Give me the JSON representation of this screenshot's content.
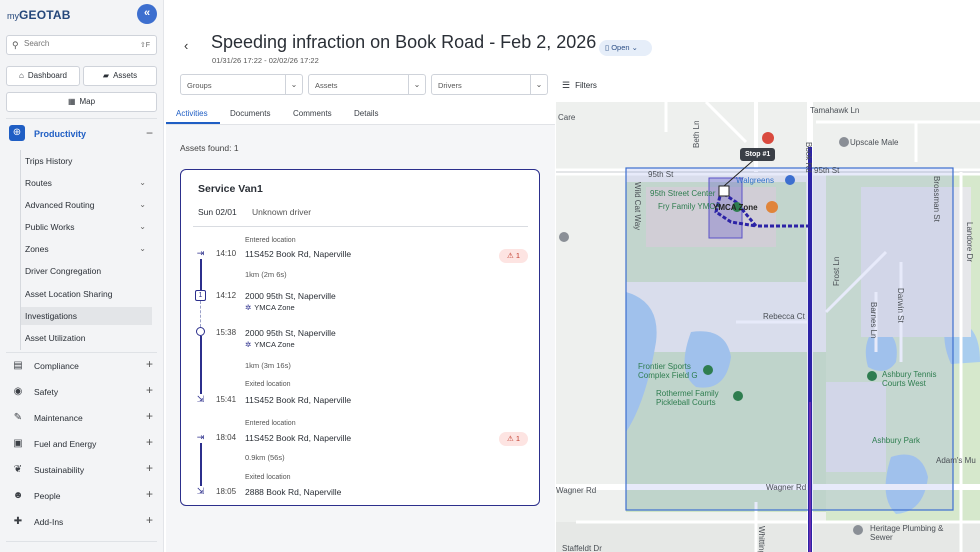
{
  "app": {
    "logo_prefix": "my",
    "logo_main": "GEOTAB",
    "collapse_icon": "«"
  },
  "sidebar": {
    "search_placeholder": "Search",
    "search_shortcut": "⇧F",
    "dashboard_label": "Dashboard",
    "assets_label": "Assets",
    "map_label": "Map",
    "productivity": {
      "label": "Productivity",
      "toggle": "−",
      "items": [
        {
          "label": "Trips History",
          "chevron": ""
        },
        {
          "label": "Routes",
          "chevron": "⌄"
        },
        {
          "label": "Advanced Routing",
          "chevron": "⌄"
        },
        {
          "label": "Public Works",
          "chevron": "⌄"
        },
        {
          "label": "Zones",
          "chevron": "⌄"
        },
        {
          "label": "Driver Congregation",
          "chevron": ""
        },
        {
          "label": "Asset Location Sharing",
          "chevron": ""
        },
        {
          "label": "Investigations",
          "chevron": ""
        },
        {
          "label": "Asset Utilization",
          "chevron": ""
        }
      ]
    },
    "categories": [
      {
        "label": "Compliance",
        "icon": "▤",
        "toggle": "+"
      },
      {
        "label": "Safety",
        "icon": "◉",
        "toggle": "+"
      },
      {
        "label": "Maintenance",
        "icon": "✎",
        "toggle": "+"
      },
      {
        "label": "Fuel and Energy",
        "icon": "▣",
        "toggle": "+"
      },
      {
        "label": "Sustainability",
        "icon": "❦",
        "toggle": "+"
      },
      {
        "label": "People",
        "icon": "☻",
        "toggle": "+"
      },
      {
        "label": "Add-Ins",
        "icon": "✚",
        "toggle": "+"
      }
    ]
  },
  "header": {
    "back_icon": "‹",
    "title": "Speeding infraction on Book Road - Feb 2, 2026",
    "status": "Open",
    "date_range": "01/31/26 17:22 - 02/02/26 17:22",
    "filters": {
      "groups_placeholder": "Groups",
      "assets_placeholder": "Assets",
      "drivers_placeholder": "Drivers",
      "filters_label": "Filters"
    }
  },
  "tabs": [
    "Activities",
    "Documents",
    "Comments",
    "Details"
  ],
  "activities": {
    "assets_found": "Assets found: 1",
    "card": {
      "title": "Service Van1",
      "date": "Sun 02/01",
      "driver": "Unknown driver",
      "events": [
        {
          "time": "14:10",
          "caption": "Entered location",
          "address": "11S452 Book Rd, Naperville",
          "warning": "1"
        },
        {
          "meta": "1km (2m 6s)"
        },
        {
          "time": "14:12",
          "address": "2000 95th St, Naperville",
          "zone": "YMCA Zone"
        },
        {
          "time": "15:38",
          "address": "2000 95th St, Naperville",
          "zone": "YMCA Zone"
        },
        {
          "meta": "1km (3m 16s)"
        },
        {
          "time": "15:41",
          "caption": "Exited location",
          "address": "11S452 Book Rd, Naperville"
        },
        {
          "time": "18:04",
          "caption": "Entered location",
          "address": "11S452 Book Rd, Naperville",
          "warning": "1"
        },
        {
          "meta": "0.9km (56s)"
        },
        {
          "time": "18:05",
          "caption": "Exited location",
          "address": "2888 Book Rd, Naperville"
        }
      ]
    }
  },
  "map": {
    "stop_label": "Stop #1",
    "labels": {
      "care": "Care",
      "tamahawk": "Tamahawk Ln",
      "upscale": "Upscale Male",
      "beth": "Beth Ln",
      "st95_left": "95th St",
      "st95_right": "95th St",
      "walgreens": "Walgreens",
      "center": "95th Street Center",
      "fry": "Fry Family YMCA",
      "ymca_zone": "YMCA Zone",
      "wildcat": "Wild Cat Way",
      "book": "Book Rd",
      "brossman": "Brossman St",
      "landore": "Landore Dr",
      "frost": "Frost Ln",
      "rebecca": "Rebecca Ct",
      "darwin": "Darwin St",
      "barnes": "Barnes Ln",
      "frontier": "Frontier Sports Complex Field G",
      "rothermel": "Rothermel Family Pickleball Courts",
      "ashbury_tennis": "Ashbury Tennis Courts West",
      "ashbury_park": "Ashbury Park",
      "adams": "Adam's Mu",
      "wagner_left": "Wagner Rd",
      "wagner_right": "Wagner Rd",
      "heritage": "Heritage Plumbing & Sewer",
      "staffeldt": "Staffeldt Dr",
      "whittington": "Whittington"
    }
  }
}
